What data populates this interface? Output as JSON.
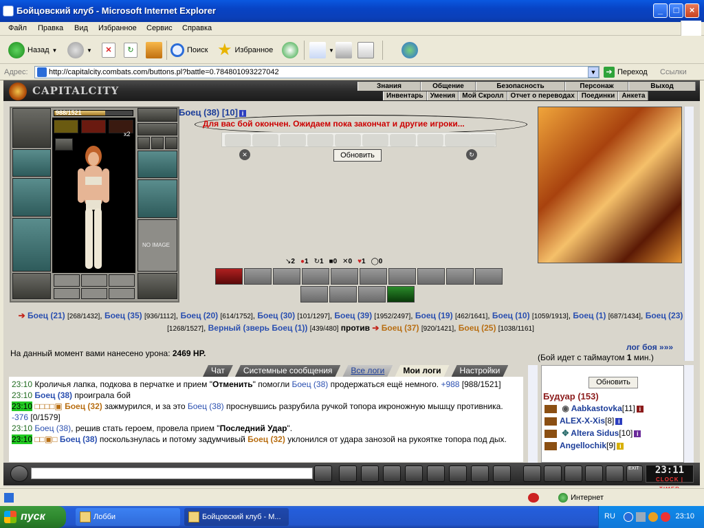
{
  "window": {
    "title": "Бойцовский клуб - Microsoft Internet Explorer"
  },
  "menu": [
    "Файл",
    "Правка",
    "Вид",
    "Избранное",
    "Сервис",
    "Справка"
  ],
  "toolbar": {
    "back": "Назад",
    "search": "Поиск",
    "favorites": "Избранное"
  },
  "address": {
    "label": "Адрес:",
    "url": "http://capitalcity.combats.com/buttons.pl?battle=0.784801093227042",
    "go": "Переход",
    "links": "Ссылки"
  },
  "game": {
    "logo": "CAPITALCITY",
    "topnav1": [
      "Знания",
      "Общение",
      "Безопасность",
      "Персонаж",
      "Выход"
    ],
    "topnav2": [
      "Инвентарь",
      "Умения",
      "Мой Скролл",
      "Отчет о переводах",
      "Поединки",
      "Анкета"
    ],
    "hp": {
      "text": "988/1521",
      "current": 988,
      "max": 1521
    },
    "x2": "x2",
    "noimage": "NO IMAGE",
    "fighter": "Боец (38) [10]",
    "notice": "Для вас бой окончен. Ожидаем пока закончат и другие игроки...",
    "refresh": "Обновить",
    "stats": [
      "2",
      "1",
      "1",
      "0",
      "0",
      "1",
      "0"
    ],
    "teams": {
      "left": [
        {
          "name": "Боец (21)",
          "hp": "[268/1432]"
        },
        {
          "name": "Боец (35)",
          "hp": "[936/1112]"
        },
        {
          "name": "Боец (20)",
          "hp": "[614/1752]"
        },
        {
          "name": "Боец (30)",
          "hp": "[101/1297]"
        },
        {
          "name": "Боец (39)",
          "hp": "[1952/2497]"
        },
        {
          "name": "Боец (19)",
          "hp": "[462/1641]"
        },
        {
          "name": "Боец (10)",
          "hp": "[1059/1913]"
        },
        {
          "name": "Боец (1)",
          "hp": "[687/1434]"
        },
        {
          "name": "Боец (23)",
          "hp": "[1268/1527]"
        },
        {
          "name": "Верный (зверь Боец (1))",
          "hp": "[439/480]"
        }
      ],
      "vs": "против",
      "right": [
        {
          "name": "Боец (37)",
          "hp": "[920/1421]"
        },
        {
          "name": "Боец (25)",
          "hp": "[1038/1161]"
        }
      ]
    },
    "damage_label": "На данный момент вами нанесено урона:",
    "damage_value": "2469 HP.",
    "battle_log": "лог боя »»»",
    "timeout": "(Бой идет с таймаутом",
    "timeout_value": "1",
    "timeout_unit": "мин.)"
  },
  "chat": {
    "tabs": [
      "Чат",
      "Системные сообщения",
      "Все логи",
      "Мои логи",
      "Настройки"
    ],
    "lines": [
      {
        "time": "23:10",
        "pre": "Кроличья лапка, подкова в перчатке и прием \"",
        "bold": "Отменить",
        "mid": "\" помогли ",
        "who": "Боец (38)",
        "post": " продержаться ещё немного. ",
        "hp": "+988",
        "tail": " [988/1521]"
      },
      {
        "time": "23:10",
        "who": "Боец (38)",
        "post": " проиграла бой"
      },
      {
        "time": "23:10",
        "marks": "□□□□▣",
        "whoO": "Боец (32)",
        "post": " зажмурился, и за это ",
        "who": "Боец (38)",
        "post2": " проснувшись разрубила ручкой топора икроножную мышцу противника. ",
        "dmg": "-376",
        "tail": " [0/1579]"
      },
      {
        "time": "23:10",
        "who": "Боец (38)",
        "post": ", решив стать героем, провела прием \"",
        "bold": "Последний Удар",
        "tail": "\"."
      },
      {
        "time": "23:10",
        "marks": "□□▣□",
        "who": "Боец (38)",
        "post": " поскользнулась и потому задумчивый ",
        "whoO": "Боец (32)",
        "post2": " уклонился от удара занозой на рукоятке топора под дых."
      }
    ]
  },
  "roster": {
    "refresh": "Обновить",
    "room": "Будуар (153)",
    "people": [
      {
        "name": "Aabkastovka",
        "lv": "[11]"
      },
      {
        "name": "ALEX-X-Xis",
        "lv": "[8]"
      },
      {
        "name": "Altera Sidus",
        "lv": "[10]"
      },
      {
        "name": "Angellochik",
        "lv": "[9]"
      }
    ]
  },
  "clock": {
    "time": "23:11",
    "label": "CLOCK",
    "timer": "TIMER",
    "exit": "EXIT"
  },
  "status": {
    "zone": "Интернет"
  },
  "taskbar": {
    "start": "пуск",
    "tasks": [
      "Лобби",
      "Бойцовский клуб - M..."
    ],
    "lang": "RU",
    "time": "23:10"
  },
  "colors": {
    "xp_blue": "#0a58e0",
    "hp_gold": "#c79a3a",
    "notice_red": "#cc0000",
    "team_blue": "#2a4fb0",
    "team_orange": "#b86e12"
  }
}
